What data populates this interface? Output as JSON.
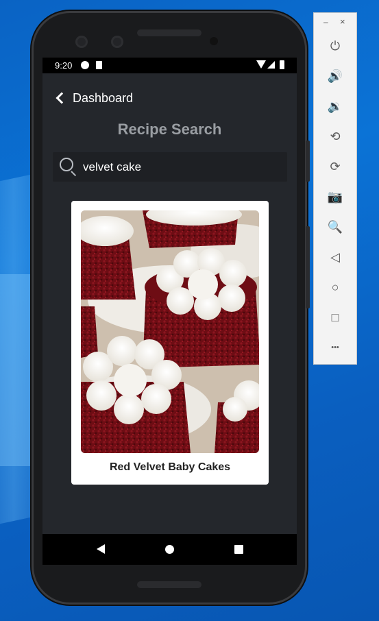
{
  "statusbar": {
    "time": "9:20"
  },
  "header": {
    "back_label": "Dashboard",
    "title": "Recipe Search"
  },
  "search": {
    "value": "velvet cake",
    "placeholder": ""
  },
  "results": [
    {
      "title": "Red Velvet Baby Cakes"
    }
  ],
  "emulator": {
    "minimize_glyph": "–",
    "close_glyph": "×",
    "tools": [
      {
        "name": "power-icon",
        "glyph": "⏻"
      },
      {
        "name": "volume-up-icon",
        "glyph": "🔊"
      },
      {
        "name": "volume-down-icon",
        "glyph": "🔉"
      },
      {
        "name": "rotate-left-icon",
        "glyph": "⟲"
      },
      {
        "name": "rotate-right-icon",
        "glyph": "⟳"
      },
      {
        "name": "camera-icon",
        "glyph": "📷"
      },
      {
        "name": "zoom-icon",
        "glyph": "🔍"
      },
      {
        "name": "back-icon",
        "glyph": "◁"
      },
      {
        "name": "home-icon",
        "glyph": "○"
      },
      {
        "name": "overview-icon",
        "glyph": "□"
      },
      {
        "name": "more-icon",
        "glyph": "•••"
      }
    ]
  },
  "colors": {
    "screen_bg": "#24272c",
    "title": "#9a9ea3",
    "search_bg": "#1e2024",
    "card_bg": "#ffffff"
  }
}
